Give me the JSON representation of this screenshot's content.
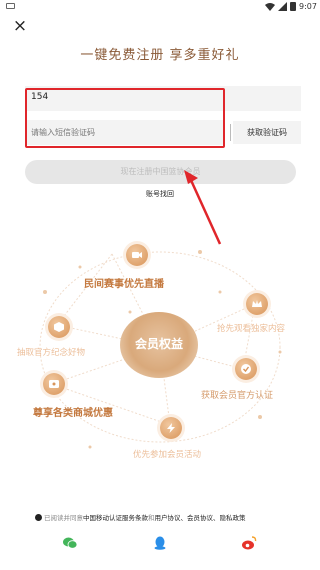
{
  "status_bar": {
    "time": "9:07"
  },
  "header": {
    "close_icon": "×",
    "headline": "一键免费注册 享多重好礼"
  },
  "form": {
    "phone_value": "154",
    "code_placeholder": "请输入短信验证码",
    "get_code_label": "获取验证码",
    "register_label": "现在注册中国篮协会员",
    "recover_label": "账号找回"
  },
  "benefits": {
    "center": "会员权益",
    "items": [
      {
        "label": "民间赛事优先直播",
        "icon": "video-icon"
      },
      {
        "label": "抢先观看独家内容",
        "icon": "crown-icon"
      },
      {
        "label": "抽取官方纪念好物",
        "icon": "gift-box-icon"
      },
      {
        "label": "获取会员官方认证",
        "icon": "badge-check-icon"
      },
      {
        "label": "尊享各类商城优惠",
        "icon": "ticket-icon"
      },
      {
        "label": "优先参加会员活动",
        "icon": "lightning-icon"
      }
    ]
  },
  "agreement": {
    "prefix": "已阅读并同意",
    "link_1": "中国移动认证服务条款",
    "joiner": "和",
    "rest": "用户协议、会员协议、隐私政策"
  },
  "social": [
    "wechat-icon",
    "qq-icon",
    "weibo-icon"
  ],
  "colors": {
    "accent": "#c4793f",
    "highlight": "#e0262b",
    "headline": "#8a5a37"
  }
}
